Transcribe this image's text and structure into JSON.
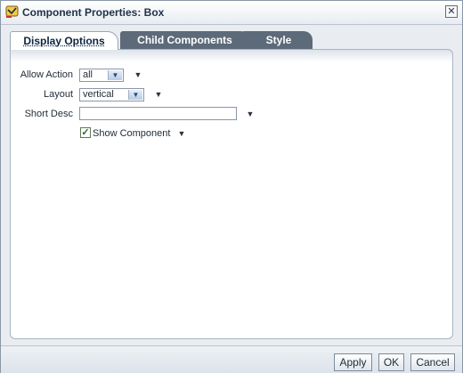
{
  "dialog": {
    "title": "Component Properties: Box",
    "close_glyph": "✕",
    "app_icon": "jdev-logo-icon"
  },
  "tabs": [
    {
      "label": "Display Options",
      "active": true
    },
    {
      "label": "Child Components",
      "active": false
    },
    {
      "label": "Style",
      "active": false
    }
  ],
  "form": {
    "allow_action": {
      "label": "Allow Action",
      "value": "all"
    },
    "layout": {
      "label": "Layout",
      "value": "vertical"
    },
    "short_desc": {
      "label": "Short Desc",
      "value": ""
    },
    "show_component": {
      "label": "Show Component",
      "checked": true
    }
  },
  "buttons": {
    "apply": "Apply",
    "ok": "OK",
    "cancel": "Cancel"
  },
  "colors": {
    "tab_inactive": "#5c6a79",
    "accent": "#23497a",
    "check": "#2c6b1e"
  }
}
